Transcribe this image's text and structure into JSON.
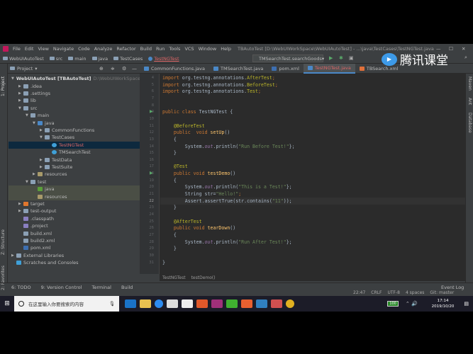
{
  "menu": [
    "File",
    "Edit",
    "View",
    "Navigate",
    "Code",
    "Analyze",
    "Refactor",
    "Build",
    "Run",
    "Tools",
    "VCS",
    "Window",
    "Help"
  ],
  "window_title": "TBAutoTest [D:\\WebUIWorkSpace\\WebUIAutoTest] - ...\\java\\TestCases\\TestNGTest.java",
  "breadcrumb": [
    "WebUIAutoTest",
    "src",
    "main",
    "java",
    "TestCases",
    "TestNGTest"
  ],
  "run_config": "TMSearchTest.searchGoods",
  "watermark": "腾讯课堂",
  "project_header": "Project",
  "tabs": [
    "CommonFunctions.java",
    "TMSearchTest.java",
    "pom.xml",
    "TestNGTest.java",
    "TBSearch.xml"
  ],
  "left_strip": [
    "1: Project",
    "Z: Structure",
    "2: Favorites"
  ],
  "right_strip": [
    "Maven",
    "Ant",
    "Database"
  ],
  "tree": [
    {
      "label": "WebUIAutoTest [TBAutoTest]",
      "extra": "D:\\WebUIWorkSpace\\Web",
      "depth": 0,
      "arrow": "▼",
      "icon": "module"
    },
    {
      "label": ".idea",
      "depth": 1,
      "arrow": "▶",
      "icon": "folder"
    },
    {
      "label": ".settings",
      "depth": 1,
      "arrow": "▶",
      "icon": "folder"
    },
    {
      "label": "lib",
      "depth": 1,
      "arrow": "▶",
      "icon": "folder"
    },
    {
      "label": "src",
      "depth": 1,
      "arrow": "▼",
      "icon": "folder"
    },
    {
      "label": "main",
      "depth": 2,
      "arrow": "▼",
      "icon": "folder"
    },
    {
      "label": "java",
      "depth": 3,
      "arrow": "▼",
      "icon": "src"
    },
    {
      "label": "CommonFunctions",
      "depth": 4,
      "arrow": "▶",
      "icon": "package"
    },
    {
      "label": "TestCases",
      "depth": 4,
      "arrow": "▼",
      "icon": "package"
    },
    {
      "label": "TestNGTest",
      "depth": 5,
      "arrow": "",
      "icon": "class",
      "state": "selected"
    },
    {
      "label": "TMSearchTest",
      "depth": 5,
      "arrow": "",
      "icon": "class"
    },
    {
      "label": "TestData",
      "depth": 4,
      "arrow": "▶",
      "icon": "package"
    },
    {
      "label": "TestSuite",
      "depth": 4,
      "arrow": "▶",
      "icon": "package"
    },
    {
      "label": "resources",
      "depth": 3,
      "arrow": "▶",
      "icon": "res"
    },
    {
      "label": "test",
      "depth": 2,
      "arrow": "▼",
      "icon": "folder"
    },
    {
      "label": "java",
      "depth": 3,
      "arrow": "",
      "icon": "testsrc",
      "state": "hl"
    },
    {
      "label": "resources",
      "depth": 3,
      "arrow": "",
      "icon": "res",
      "state": "hl"
    },
    {
      "label": "target",
      "depth": 1,
      "arrow": "▶",
      "icon": "target"
    },
    {
      "label": "test-output",
      "depth": 1,
      "arrow": "▶",
      "icon": "folder"
    },
    {
      "label": ".classpath",
      "depth": 1,
      "arrow": "",
      "icon": "file"
    },
    {
      "label": ".project",
      "depth": 1,
      "arrow": "",
      "icon": "file"
    },
    {
      "label": "build.xml",
      "depth": 1,
      "arrow": "",
      "icon": "xml"
    },
    {
      "label": "build2.xml",
      "depth": 1,
      "arrow": "",
      "icon": "xml"
    },
    {
      "label": "pom.xml",
      "depth": 1,
      "arrow": "",
      "icon": "maven"
    },
    {
      "label": "External Libraries",
      "depth": 0,
      "arrow": "▶",
      "icon": "lib"
    },
    {
      "label": "Scratches and Consoles",
      "depth": 0,
      "arrow": "",
      "icon": "scratch"
    }
  ],
  "code": [
    {
      "n": "4",
      "t": [
        [
          "kw",
          "import "
        ],
        [
          "",
          "org.testng.annotations."
        ],
        [
          "an",
          "AfterTest"
        ],
        [
          "kw",
          ";"
        ]
      ]
    },
    {
      "n": "5",
      "t": [
        [
          "kw",
          "import "
        ],
        [
          "",
          "org.testng.annotations."
        ],
        [
          "an",
          "BeforeTest"
        ],
        [
          "kw",
          ";"
        ]
      ]
    },
    {
      "n": "6",
      "t": [
        [
          "kw",
          "import "
        ],
        [
          "",
          "org.testng.annotations."
        ],
        [
          "an",
          "Test"
        ],
        [
          "kw",
          ";"
        ]
      ]
    },
    {
      "n": "7",
      "t": []
    },
    {
      "n": "8",
      "t": []
    },
    {
      "n": "9",
      "t": [
        [
          "kw",
          "public class "
        ],
        [
          "",
          "TestNGTest {"
        ]
      ]
    },
    {
      "n": "10",
      "t": []
    },
    {
      "n": "11",
      "t": [
        [
          "an",
          "    @BeforeTest"
        ]
      ]
    },
    {
      "n": "12",
      "t": [
        [
          "kw",
          "    public  void "
        ],
        [
          "fn",
          "setUp"
        ],
        [
          "",
          "()"
        ]
      ]
    },
    {
      "n": "13",
      "t": [
        [
          "",
          "    {"
        ]
      ]
    },
    {
      "n": "14",
      "t": [
        [
          "",
          "        System."
        ],
        [
          "fd",
          "out"
        ],
        [
          "",
          ".println("
        ],
        [
          "st",
          "\"Run Before Test!\""
        ],
        [
          "",
          "};"
        ]
      ]
    },
    {
      "n": "15",
      "t": [
        [
          "",
          "    }"
        ]
      ]
    },
    {
      "n": "16",
      "t": []
    },
    {
      "n": "17",
      "t": [
        [
          "an",
          "    @Test"
        ]
      ]
    },
    {
      "n": "18",
      "t": [
        [
          "kw",
          "    public void "
        ],
        [
          "fn",
          "testDemo"
        ],
        [
          "",
          "()"
        ]
      ]
    },
    {
      "n": "19",
      "t": [
        [
          "",
          "    {"
        ]
      ]
    },
    {
      "n": "20",
      "t": [
        [
          "",
          "        System."
        ],
        [
          "fd",
          "out"
        ],
        [
          "",
          ".println("
        ],
        [
          "st",
          "\"This is a Test!\""
        ],
        [
          "",
          "};"
        ]
      ]
    },
    {
      "n": "21",
      "t": [
        [
          "",
          "        String str="
        ],
        [
          "st",
          "\"Hello!\""
        ],
        [
          "kw",
          ";"
        ]
      ]
    },
    {
      "n": "22",
      "t": [
        [
          "",
          "        Assert.assertTrue(str.contains("
        ],
        [
          "st",
          "\"11\""
        ],
        [
          "",
          "));"
        ]
      ]
    },
    {
      "n": "23",
      "t": [
        [
          "",
          "    }"
        ]
      ]
    },
    {
      "n": "24",
      "t": []
    },
    {
      "n": "25",
      "t": [
        [
          "an",
          "    @AfterTest"
        ]
      ]
    },
    {
      "n": "26",
      "t": [
        [
          "kw",
          "    public void "
        ],
        [
          "fn",
          "tearDown"
        ],
        [
          "",
          "()"
        ]
      ]
    },
    {
      "n": "27",
      "t": [
        [
          "",
          "    {"
        ]
      ]
    },
    {
      "n": "28",
      "t": [
        [
          "",
          "        System."
        ],
        [
          "fd",
          "out"
        ],
        [
          "",
          ".println("
        ],
        [
          "st",
          "\"Run After Test!\""
        ],
        [
          "",
          "};"
        ]
      ]
    },
    {
      "n": "29",
      "t": [
        [
          "",
          "    }"
        ]
      ]
    },
    {
      "n": "30",
      "t": []
    },
    {
      "n": "31",
      "t": [
        [
          "",
          "}"
        ]
      ]
    }
  ],
  "editor_crumbs": [
    "TestNGTest",
    "testDemo()"
  ],
  "tool_windows": [
    "6: TODO",
    "9: Version Control",
    "Terminal",
    "Build"
  ],
  "event_log": "Event Log",
  "status": {
    "position": "22:47",
    "line_sep": "CRLF",
    "encoding": "UTF-8",
    "indent": "4 spaces",
    "git": "Git: master"
  },
  "taskbar": {
    "search_placeholder": "在这里输入你要搜索的内容",
    "battery": "100",
    "time": "17:14",
    "date": "2019/10/20"
  },
  "colors": {
    "accent": "#4a88c7",
    "bg": "#2b2b2b",
    "panel": "#3c3f41"
  }
}
